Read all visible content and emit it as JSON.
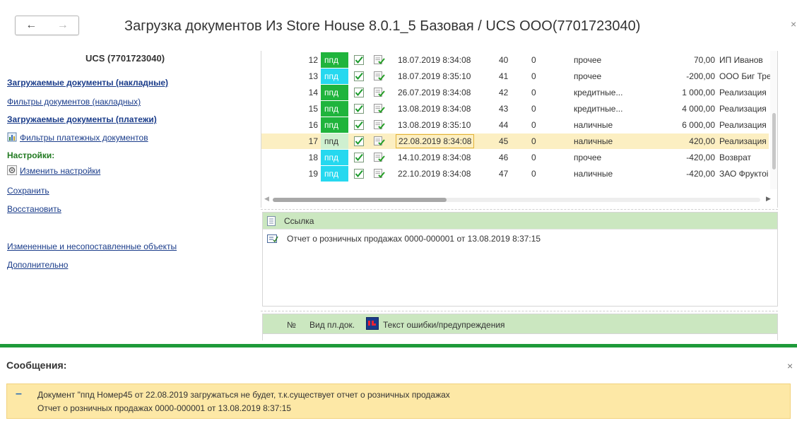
{
  "window": {
    "title": "Загрузка документов Из Store House 8.0.1_5 Базовая   / UCS ООО(7701723040)",
    "close_glyph": "×"
  },
  "nav": {
    "back": "←",
    "forward": "→"
  },
  "left": {
    "org": "UCS (7701723040)",
    "links": {
      "loaded_invoices": "Загружаемые документы (накладные)",
      "filters_invoices": "Фильтры документов (накладных)",
      "loaded_payments": "Загружаемые документы (платежи)",
      "filters_payments": "Фильтры платежных документов",
      "settings_section": "Настройки:",
      "change_settings": "Изменить настройки",
      "save": "Сохранить",
      "restore": "Восстановить",
      "changed_objects": "Измененные и несопоставленные объекты",
      "more": "Дополнительно"
    }
  },
  "table": {
    "rows": [
      {
        "n": "12",
        "type": "ппд",
        "type_style": "g",
        "date": "18.07.2019 8:34:08",
        "a": "40",
        "b": "0",
        "kind": "прочее",
        "sum": "70,00",
        "who": "ИП Иванов"
      },
      {
        "n": "13",
        "type": "ппд",
        "type_style": "c",
        "date": "18.07.2019 8:35:10",
        "a": "41",
        "b": "0",
        "kind": "прочее",
        "sum": "-200,00",
        "who": "ООО Биг Тре"
      },
      {
        "n": "14",
        "type": "ппд",
        "type_style": "g",
        "date": "26.07.2019 8:34:08",
        "a": "42",
        "b": "0",
        "kind": "кредитные...",
        "sum": "1 000,00",
        "who": "Реализация"
      },
      {
        "n": "15",
        "type": "ппд",
        "type_style": "g",
        "date": "13.08.2019 8:34:08",
        "a": "43",
        "b": "0",
        "kind": "кредитные...",
        "sum": "4 000,00",
        "who": "Реализация"
      },
      {
        "n": "16",
        "type": "ппд",
        "type_style": "g",
        "date": "13.08.2019 8:35:10",
        "a": "44",
        "b": "0",
        "kind": "наличные",
        "sum": "6 000,00",
        "who": "Реализация"
      },
      {
        "n": "17",
        "type": "ппд",
        "type_style": "l",
        "date": "22.08.2019 8:34:08",
        "a": "45",
        "b": "0",
        "kind": "наличные",
        "sum": "420,00",
        "who": "Реализация"
      },
      {
        "n": "18",
        "type": "ппд",
        "type_style": "c",
        "date": "14.10.2019 8:34:08",
        "a": "46",
        "b": "0",
        "kind": "прочее",
        "sum": "-420,00",
        "who": "Возврат"
      },
      {
        "n": "19",
        "type": "ппд",
        "type_style": "c",
        "date": "22.10.2019 8:34:08",
        "a": "47",
        "b": "0",
        "kind": "наличные",
        "sum": "-420,00",
        "who": "ЗАО Фруктоі"
      }
    ],
    "selected_row": 5
  },
  "ref": {
    "header": "Ссылка",
    "value": "Отчет о розничных продажах 0000-000001 от 13.08.2019 8:37:15"
  },
  "errors": {
    "col_num": "№",
    "col_type": "Вид пл.док.",
    "col_text": "Текст ошибки/предупреждения"
  },
  "messages": {
    "title": "Сообщения:",
    "close_glyph": "×",
    "marker": "–",
    "line1": "Документ \"ппд Номер45 от 22.08.2019 загружаться не будет, т.к.существует отчет о розничных продажах",
    "line2": "Отчет о розничных продажах 0000-000001 от 13.08.2019 8:37:15"
  },
  "colors": {
    "accent_green": "#1f9a3a",
    "type_green": "#1fb43c",
    "type_cyan": "#26d8ef",
    "selection": "#fcefc2",
    "message_bg": "#fde8a6",
    "link": "#1a3c8a"
  }
}
